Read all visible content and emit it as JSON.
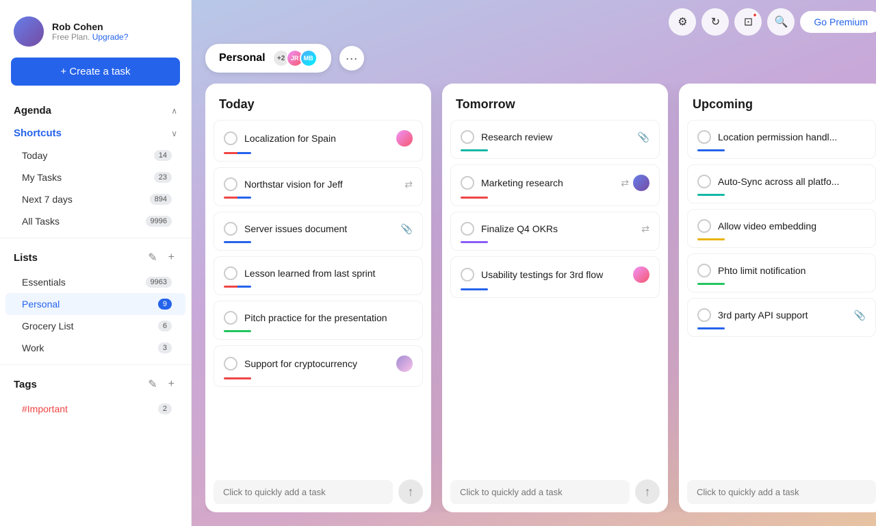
{
  "sidebar": {
    "user": {
      "name": "Rob Cohen",
      "plan": "Free Plan.",
      "upgrade": "Upgrade?"
    },
    "create_task_label": "+ Create a task",
    "agenda_label": "Agenda",
    "shortcuts_label": "Shortcuts",
    "nav_items": [
      {
        "label": "Today",
        "badge": "14"
      },
      {
        "label": "My Tasks",
        "badge": "23"
      },
      {
        "label": "Next 7 days",
        "badge": "894"
      },
      {
        "label": "All Tasks",
        "badge": "9996"
      }
    ],
    "lists_label": "Lists",
    "list_items": [
      {
        "label": "Essentials",
        "badge": "9963",
        "active": false
      },
      {
        "label": "Personal",
        "badge": "9",
        "active": true
      },
      {
        "label": "Grocery List",
        "badge": "6",
        "active": false
      },
      {
        "label": "Work",
        "badge": "3",
        "active": false
      }
    ],
    "tags_label": "Tags",
    "tag_items": [
      {
        "label": "#Important",
        "badge": "2"
      }
    ]
  },
  "topbar": {
    "gear_label": "⚙",
    "refresh_label": "↻",
    "notification_label": "□",
    "search_label": "🔍",
    "premium_label": "Go Premium"
  },
  "board": {
    "tab_label": "Personal",
    "member_count": "+2",
    "columns": [
      {
        "id": "today",
        "header": "Today",
        "tasks": [
          {
            "title": "Localization for Spain",
            "bar": "bar-red-blue",
            "has_avatar": true,
            "avatar_style": "background: linear-gradient(135deg, #f093fb, #f5576c);"
          },
          {
            "title": "Northstar vision for Jeff",
            "bar": "bar-red-blue",
            "has_avatar": false,
            "has_subtask_icon": true
          },
          {
            "title": "Server issues document",
            "bar": "bar-blue",
            "has_avatar": false,
            "has_attach": true
          },
          {
            "title": "Lesson learned from last sprint",
            "bar": "bar-red-blue",
            "has_avatar": false
          },
          {
            "title": "Pitch practice for the presentation",
            "bar": "bar-green",
            "has_avatar": false
          },
          {
            "title": "Support for cryptocurrency",
            "bar": "bar-red",
            "has_avatar": true,
            "avatar_style": "background: linear-gradient(135deg, #a18cd1, #fbc2eb);"
          }
        ],
        "quick_add_placeholder": "Click to quickly add a task"
      },
      {
        "id": "tomorrow",
        "header": "Tomorrow",
        "tasks": [
          {
            "title": "Research review",
            "bar": "bar-teal",
            "has_avatar": false,
            "has_attach": true
          },
          {
            "title": "Marketing research",
            "bar": "bar-red",
            "has_avatar": true,
            "avatar_style": "background: linear-gradient(135deg, #667eea, #764ba2);",
            "has_subtask_icon": true
          },
          {
            "title": "Finalize Q4 OKRs",
            "bar": "bar-purple",
            "has_avatar": false,
            "has_subtask_icon": true
          },
          {
            "title": "Usability testings for 3rd flow",
            "bar": "bar-blue",
            "has_avatar": true,
            "avatar_style": "background: linear-gradient(135deg, #f093fb, #f5576c);"
          }
        ],
        "quick_add_placeholder": "Click to quickly add a task"
      },
      {
        "id": "upcoming",
        "header": "Upcoming",
        "tasks": [
          {
            "title": "Location permission handl...",
            "bar": "bar-blue",
            "has_avatar": false
          },
          {
            "title": "Auto-Sync across all platfo...",
            "bar": "bar-teal",
            "has_avatar": false
          },
          {
            "title": "Allow video embedding",
            "bar": "bar-yellow",
            "has_avatar": false
          },
          {
            "title": "Phto limit notification",
            "bar": "bar-green",
            "has_avatar": false
          },
          {
            "title": "3rd party API support",
            "bar": "bar-blue",
            "has_avatar": false,
            "has_attach": true
          }
        ],
        "quick_add_placeholder": "Click to quickly add a task"
      }
    ]
  }
}
